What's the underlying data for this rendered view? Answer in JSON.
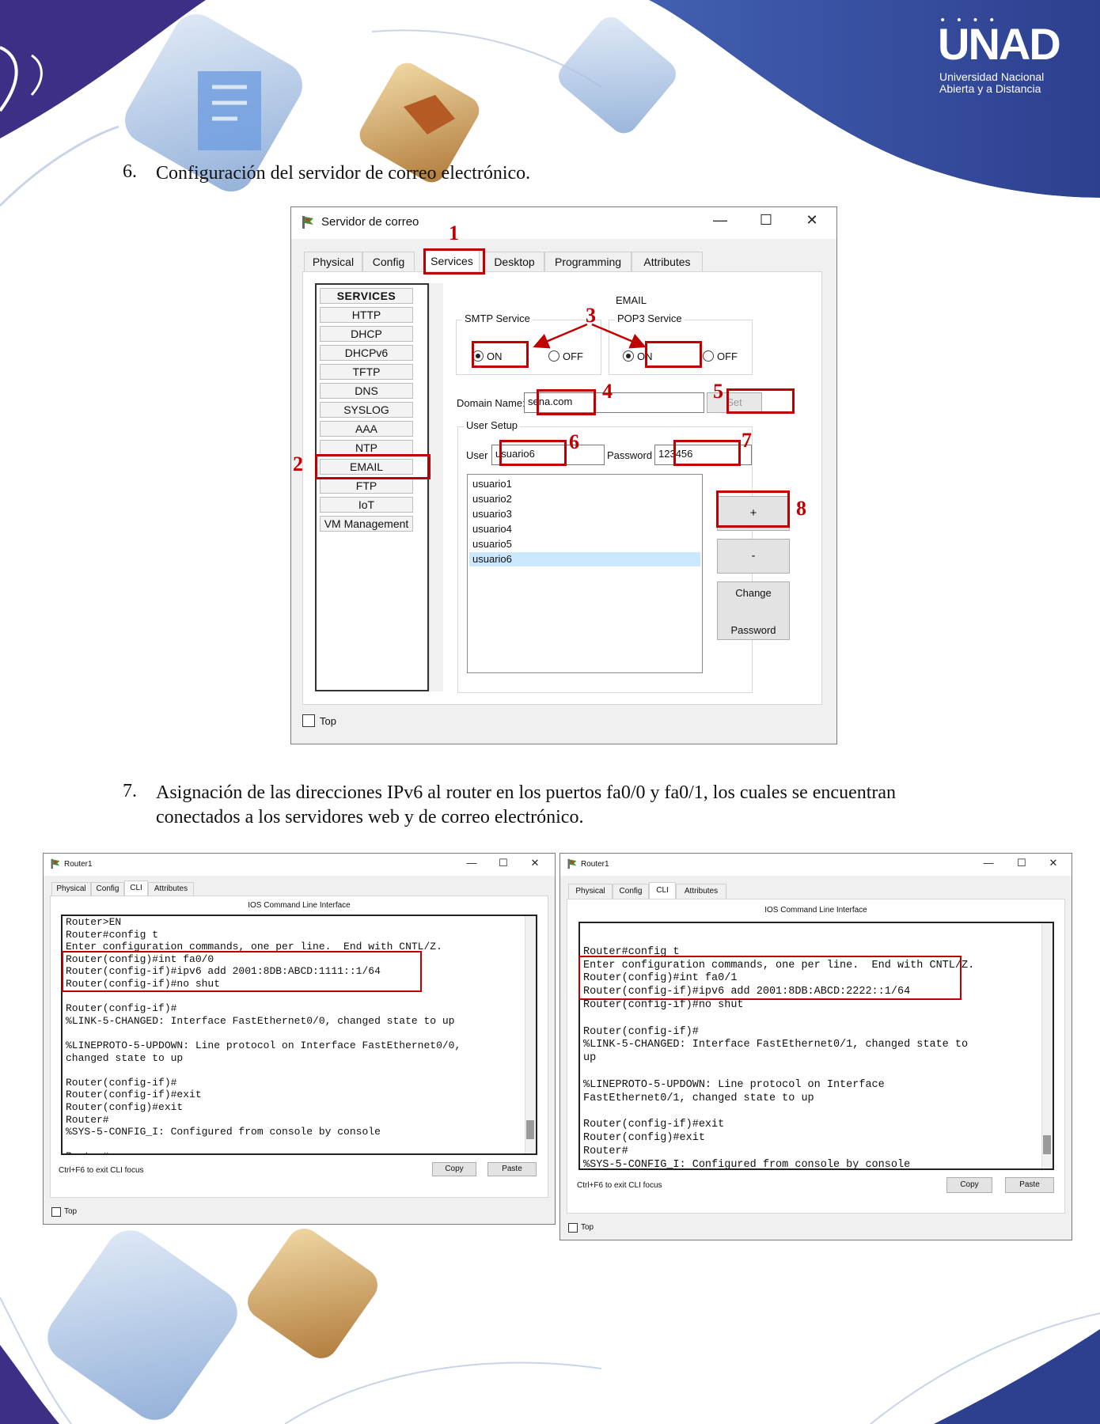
{
  "logo": {
    "big": "UNAD",
    "sub1": "Universidad Nacional",
    "sub2": "Abierta y a Distancia"
  },
  "section6": {
    "number": "6.",
    "text": "Configuración del servidor de correo electrónico."
  },
  "email_window": {
    "title": "Servidor de correo",
    "controls": {
      "minimize": "—",
      "maximize": "☐",
      "close": "✕"
    },
    "tabs": [
      "Physical",
      "Config",
      "Services",
      "Desktop",
      "Programming",
      "Attributes"
    ],
    "services": [
      "SERVICES",
      "HTTP",
      "DHCP",
      "DHCPv6",
      "TFTP",
      "DNS",
      "SYSLOG",
      "AAA",
      "NTP",
      "EMAIL",
      "FTP",
      "IoT",
      "VM Management"
    ],
    "panel_title": "EMAIL",
    "smtp": {
      "label": "SMTP Service",
      "on": "ON",
      "off": "OFF"
    },
    "pop3": {
      "label": "POP3 Service",
      "on": "ON",
      "off": "OFF"
    },
    "domain_label": "Domain Name:",
    "domain_value": "sena.com",
    "set_button": "Set",
    "user_setup_label": "User Setup",
    "user_label": "User",
    "user_value": "usuario6",
    "password_label": "Password",
    "password_value": "123456",
    "users": [
      "usuario1",
      "usuario2",
      "usuario3",
      "usuario4",
      "usuario5",
      "usuario6"
    ],
    "add_button": "+",
    "remove_button": "-",
    "change_button_line1": "Change",
    "change_button_line2": "Password",
    "top_label": "Top",
    "annotations": [
      "1",
      "2",
      "3",
      "4",
      "5",
      "6",
      "7",
      "8"
    ]
  },
  "section7": {
    "number": "7.",
    "line1": "Asignación de las direcciones IPv6 al router en los puertos fa0/0 y fa0/1, los cuales se encuentran",
    "line2": "conectados a los servidores web y de correo electrónico."
  },
  "router_left": {
    "title": "Router1",
    "controls": {
      "minimize": "—",
      "maximize": "☐",
      "close": "✕"
    },
    "tabs": [
      "Physical",
      "Config",
      "CLI",
      "Attributes"
    ],
    "cli_heading": "IOS Command Line Interface",
    "lines": [
      "Router>EN",
      "Router#config t",
      "Enter configuration commands, one per line.  End with CNTL/Z.",
      "Router(config)#int fa0/0",
      "Router(config-if)#ipv6 add 2001:8DB:ABCD:1111::1/64",
      "Router(config-if)#no shut",
      "",
      "Router(config-if)#",
      "%LINK-5-CHANGED: Interface FastEthernet0/0, changed state to up",
      "",
      "%LINEPROTO-5-UPDOWN: Line protocol on Interface FastEthernet0/0,",
      "changed state to up",
      "",
      "Router(config-if)#",
      "Router(config-if)#exit",
      "Router(config)#exit",
      "Router#",
      "%SYS-5-CONFIG_I: Configured from console by console",
      "",
      "Router#"
    ],
    "hint": "Ctrl+F6 to exit CLI focus",
    "copy": "Copy",
    "paste": "Paste",
    "top_label": "Top"
  },
  "router_right": {
    "title": "Router1",
    "controls": {
      "minimize": "—",
      "maximize": "☐",
      "close": "✕"
    },
    "tabs": [
      "Physical",
      "Config",
      "CLI",
      "Attributes"
    ],
    "cli_heading": "IOS Command Line Interface",
    "lines": [
      "",
      "Router#config t",
      "Enter configuration commands, one per line.  End with CNTL/Z.",
      "Router(config)#int fa0/1",
      "Router(config-if)#ipv6 add 2001:8DB:ABCD:2222::1/64",
      "Router(config-if)#no shut",
      "",
      "Router(config-if)#",
      "%LINK-5-CHANGED: Interface FastEthernet0/1, changed state to",
      "up",
      "",
      "%LINEPROTO-5-UPDOWN: Line protocol on Interface",
      "FastEthernet0/1, changed state to up",
      "",
      "Router(config-if)#exit",
      "Router(config)#exit",
      "Router#",
      "%SYS-5-CONFIG_I: Configured from console by console"
    ],
    "hint": "Ctrl+F6 to exit CLI focus",
    "copy": "Copy",
    "paste": "Paste",
    "top_label": "Top"
  },
  "colors": {
    "annotation": "#c00000",
    "brand_blue": "#2f4fa8",
    "brand_gold": "#b87333",
    "selection": "#cce8ff"
  }
}
